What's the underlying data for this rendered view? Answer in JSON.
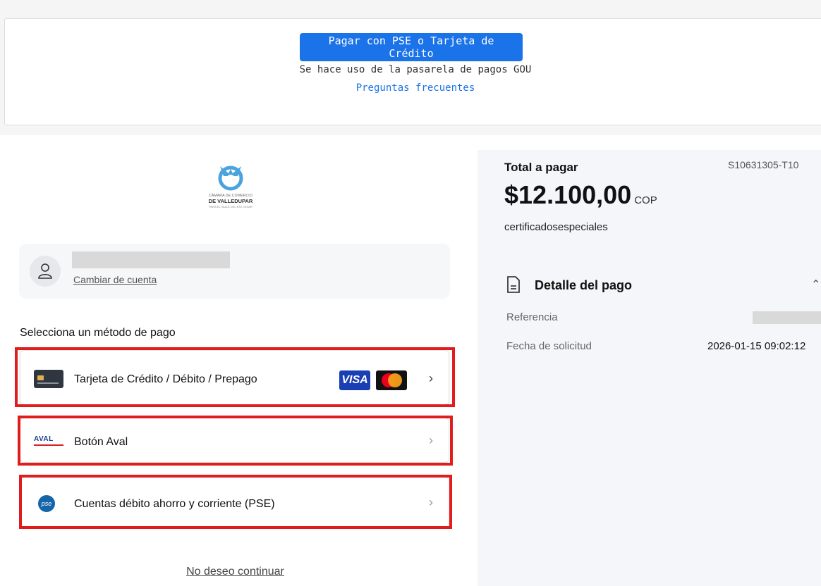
{
  "gateway": {
    "pay_button_label": "Pagar con PSE o Tarjeta de Crédito",
    "note": "Se hace uso de la pasarela de pagos GOU",
    "faq_link": "Preguntas frecuentes"
  },
  "merchant": {
    "logo_line1": "CÁMARA DE COMERCIO",
    "logo_line2": "DE VALLEDUPAR",
    "logo_line3": "PARA EL VALLE DEL RÍO CESAR"
  },
  "account": {
    "change_account_link": "Cambiar de cuenta",
    "avatar_icon": "user-icon"
  },
  "payment_methods": {
    "heading": "Selecciona un método de pago",
    "items": [
      {
        "label": "Tarjeta de Crédito / Débito / Prepago",
        "icon": "credit-card-icon",
        "brands": [
          "VISA",
          "Mastercard"
        ]
      },
      {
        "label": "Botón Aval",
        "icon": "aval-logo-icon",
        "icon_text": "AVAL"
      },
      {
        "label": "Cuentas débito ahorro y corriente (PSE)",
        "icon": "pse-logo-icon",
        "icon_text": "pse"
      }
    ],
    "highlight_color": "#e01c1c"
  },
  "exit_link": "No deseo continuar",
  "summary": {
    "order_code": "S10631305-T10",
    "total_label": "Total a pagar",
    "amount": "$12.100,00",
    "currency": "COP",
    "concept": "certificadosespeciales",
    "detail_title": "Detalle del pago",
    "reference_label": "Referencia",
    "request_date_label": "Fecha de solicitud",
    "request_date_value": "2026-01-15 09:02:12"
  },
  "colors": {
    "primary": "#1a73e8",
    "panel_bg": "#f4f6fa"
  }
}
